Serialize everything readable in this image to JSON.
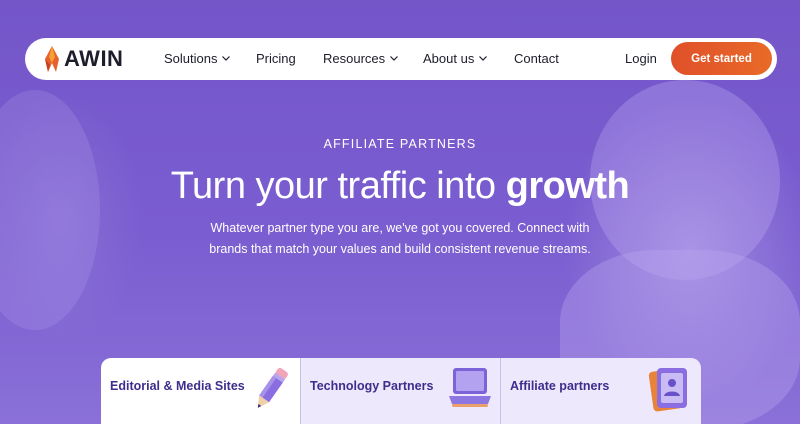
{
  "brand": {
    "name": "AWIN"
  },
  "nav": {
    "items": [
      {
        "label": "Solutions",
        "has_dropdown": true
      },
      {
        "label": "Pricing",
        "has_dropdown": false
      },
      {
        "label": "Resources",
        "has_dropdown": true
      },
      {
        "label": "About us",
        "has_dropdown": true
      },
      {
        "label": "Contact",
        "has_dropdown": false
      }
    ],
    "login": "Login",
    "cta": "Get started"
  },
  "hero": {
    "eyebrow": "AFFILIATE PARTNERS",
    "headline_regular": "Turn your traffic into ",
    "headline_bold": "growth",
    "subtext": "Whatever partner type you are, we've got you covered. Connect with brands that match your values and build consistent revenue streams."
  },
  "cards": [
    {
      "label": "Editorial & Media Sites",
      "icon": "pencil-icon",
      "active": true
    },
    {
      "label": "Technology Partners",
      "icon": "laptop-icon",
      "active": false
    },
    {
      "label": "Affiliate partners",
      "icon": "profile-card-icon",
      "active": false
    }
  ],
  "colors": {
    "hero_purple": "#7456c9",
    "cta_orange": "#e0502a",
    "card_text": "#3f2d8e",
    "card_inactive_bg": "#ede8fb"
  }
}
